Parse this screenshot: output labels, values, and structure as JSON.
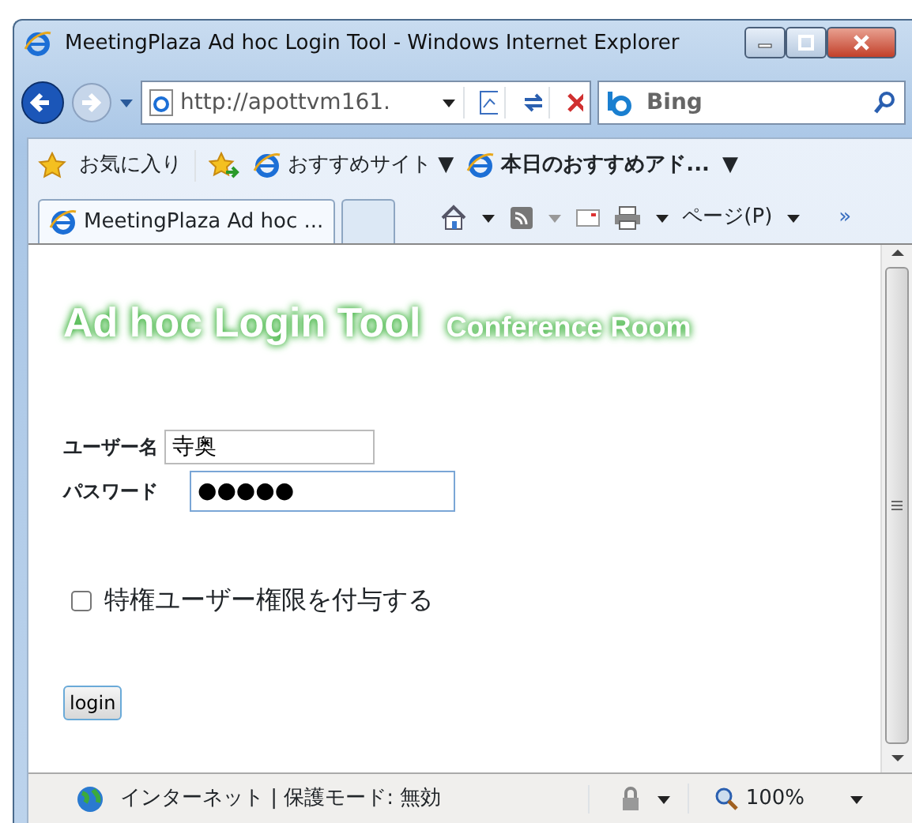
{
  "window": {
    "title": "MeetingPlaza Ad hoc Login Tool - Windows Internet Explorer"
  },
  "address_bar": {
    "url": "http://apottvm161.",
    "search_engine": "Bing"
  },
  "favorites_bar": {
    "favorites": "お気に入り",
    "items": [
      {
        "label": "おすすめサイト ▼"
      },
      {
        "label": "本日のおすすめアド...",
        "bold": true
      },
      {
        "label": "▼"
      }
    ]
  },
  "tabs": [
    {
      "label": "MeetingPlaza Ad hoc ...",
      "selected": true
    },
    {
      "selected": false
    }
  ],
  "command_bar": {
    "page_menu": "ページ(P)",
    "more": "»"
  },
  "page": {
    "title": "Ad hoc Login Tool",
    "subtitle": "Conference Room",
    "username_label": "ユーザー名",
    "username": "寺奥",
    "password_label": "パスワード",
    "password": "●●●●●",
    "password_focused": true,
    "privilege": {
      "label": "特権ユーザー権限を付与する",
      "checked": false
    },
    "login_button": "login"
  },
  "status_bar": {
    "zone": "インターネット | 保護モード: 無効",
    "zoom": "100%"
  }
}
